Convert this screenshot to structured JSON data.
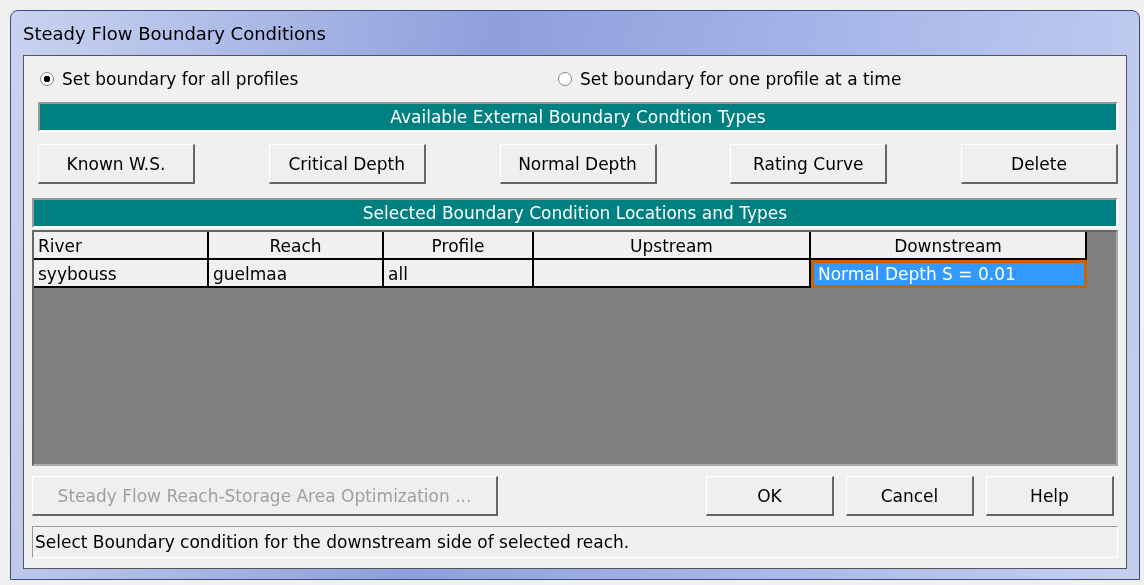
{
  "window": {
    "title": "Steady Flow Boundary Conditions"
  },
  "mode_options": [
    {
      "label": "Set boundary for all profiles",
      "selected": true
    },
    {
      "label": "Set boundary for one profile at a time",
      "selected": false
    }
  ],
  "types_header": "Available External Boundary Condtion Types",
  "type_buttons": [
    "Known W.S.",
    "Critical Depth",
    "Normal Depth",
    "Rating Curve",
    "Delete"
  ],
  "locations_header": "Selected Boundary Condition Locations and Types",
  "table": {
    "columns": [
      {
        "label": "River"
      },
      {
        "label": "Reach"
      },
      {
        "label": "Profile"
      },
      {
        "label": "Upstream"
      },
      {
        "label": "Downstream"
      }
    ],
    "rows": [
      {
        "cells": [
          {
            "text": "syybouss",
            "selected": false
          },
          {
            "text": "guelmaa",
            "selected": false
          },
          {
            "text": "all",
            "selected": false
          },
          {
            "text": "",
            "selected": false
          },
          {
            "text": "Normal Depth S = 0.01",
            "selected": true
          }
        ]
      }
    ]
  },
  "bottom_buttons": [
    {
      "label": "Steady Flow Reach-Storage Area Optimization ...",
      "disabled": true
    },
    {
      "label": "OK",
      "disabled": false
    },
    {
      "label": "Cancel",
      "disabled": false
    },
    {
      "label": "Help",
      "disabled": false
    }
  ],
  "status_bar": "Select Boundary condition for the downstream side of selected reach."
}
